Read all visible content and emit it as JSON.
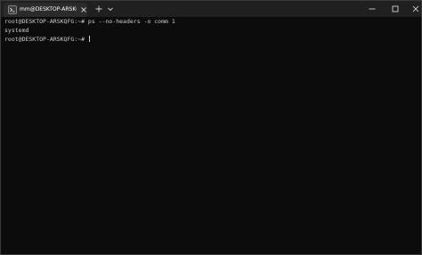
{
  "tab": {
    "title": "mm@DESKTOP-ARSKQFG: /e",
    "icon": "terminal-icon",
    "close_icon": "close-icon"
  },
  "titlebar": {
    "new_tab_icon": "plus-icon",
    "dropdown_icon": "chevron-down-icon",
    "minimize_icon": "minimize-icon",
    "maximize_icon": "maximize-icon",
    "close_icon": "close-icon"
  },
  "terminal": {
    "lines": [
      "root@DESKTOP-ARSKQFG:~# ps --no-headers -o comm 1",
      "systemd",
      "root@DESKTOP-ARSKQFG:~# "
    ]
  },
  "colors": {
    "background": "#0c0c0c",
    "titlebar": "#202020",
    "active_tab": "#2b2b2b",
    "text": "#cccccc"
  }
}
